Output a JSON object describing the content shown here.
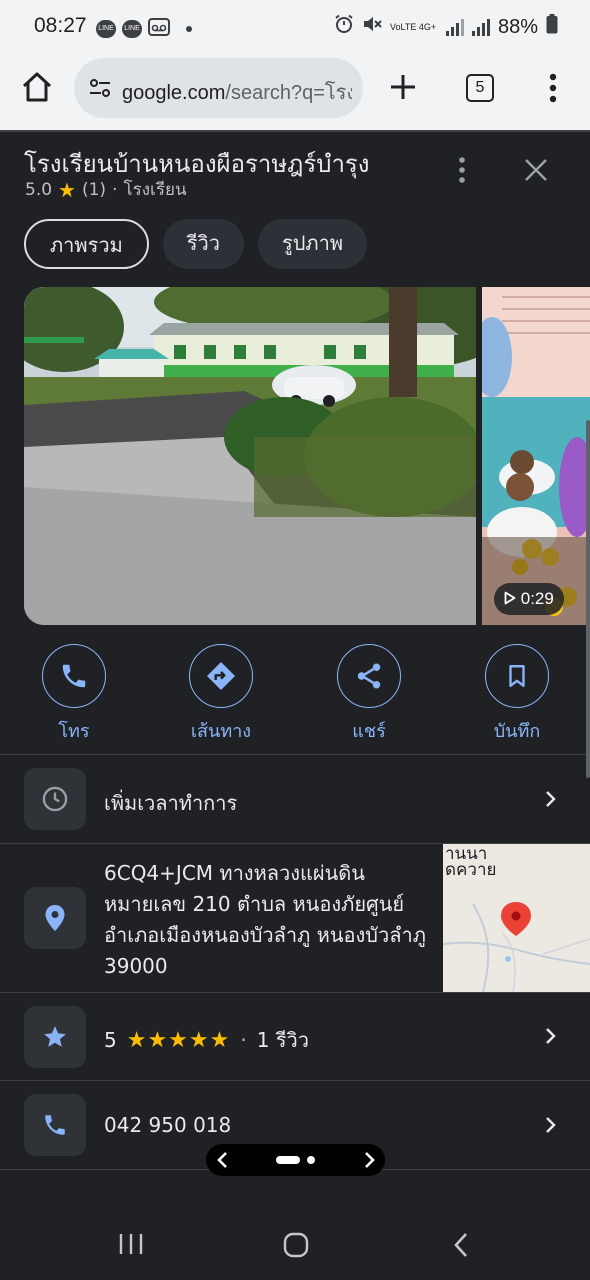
{
  "status_bar": {
    "time": "08:27",
    "notif_icons": [
      "line-icon",
      "line-icon",
      "voicemail-icon"
    ],
    "network": "VoLTE 4G+",
    "battery": "88%"
  },
  "browser": {
    "url_host": "google.com",
    "url_rest": "/search?q=โรง",
    "tab_count": "5"
  },
  "place": {
    "title": "โรงเรียนบ้านหนองผือราษฎร์บำรุง",
    "rating": "5.0",
    "review_count": "(1)",
    "separator": "·",
    "category": "โรงเรียน",
    "tabs": [
      {
        "label": "ภาพรวม",
        "active": true
      },
      {
        "label": "รีวิว",
        "active": false
      },
      {
        "label": "รูปภาพ",
        "active": false
      }
    ],
    "video_duration": "0:29",
    "actions": [
      {
        "label": "โทร",
        "icon": "phone-icon"
      },
      {
        "label": "เส้นทาง",
        "icon": "directions-icon"
      },
      {
        "label": "แชร์",
        "icon": "share-icon"
      },
      {
        "label": "บันทึก",
        "icon": "bookmark-icon"
      }
    ],
    "hours_text": "เพิ่มเวลาทำการ",
    "address_lines": [
      "6CQ4+JCM ทางหลวงแผ่นดิน",
      "หมายเลข 210 ตำบล หนองภัยศูนย์",
      "อำเภอเมืองหนองบัวลำภู หนองบัวลำภู",
      "39000"
    ],
    "map_labels": [
      "านนา",
      "ดควาย"
    ],
    "review_score": "5",
    "review_stars": 5,
    "review_text": "1 รีวิว",
    "phone": "042 950 018"
  },
  "colors": {
    "accent": "#8ab4f8",
    "star": "#fbbc04",
    "panel_bg": "#1f2124",
    "map_pin": "#ea4335"
  }
}
